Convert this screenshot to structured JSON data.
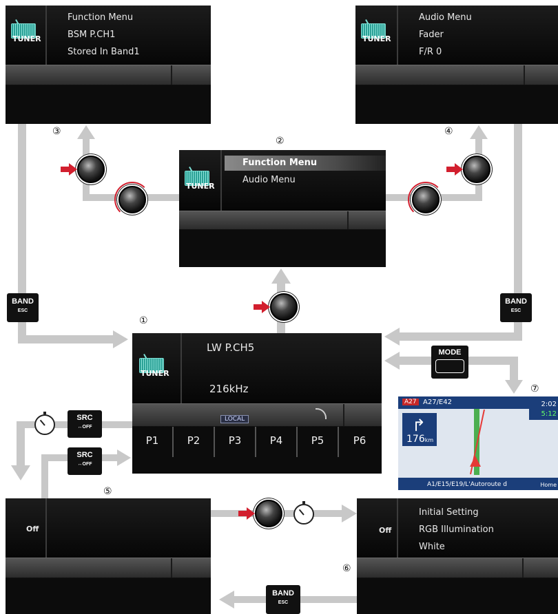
{
  "markers": {
    "m1": "①",
    "m2": "②",
    "m3": "③",
    "m4": "④",
    "m5": "⑤",
    "m6": "⑥",
    "m7": "⑦"
  },
  "tuner_label": "TUNER",
  "screen_top_left": {
    "line1": "Function Menu",
    "line2": "BSM P.CH1",
    "line3": "Stored In Band1"
  },
  "screen_top_right": {
    "line1": "Audio Menu",
    "line2": "Fader",
    "line3": "F/R 0"
  },
  "screen_center": {
    "item1": "Function Menu",
    "item2": "Audio Menu"
  },
  "screen_main": {
    "station": "LW P.CH5",
    "frequency": "216kHz",
    "local_badge": "LOCAL",
    "presets": [
      "P1",
      "P2",
      "P3",
      "P4",
      "P5",
      "P6"
    ]
  },
  "screen_off_left": {
    "label": "Off"
  },
  "screen_off_right": {
    "label": "Off",
    "line1": "Initial Setting",
    "line2": "RGB Illumination",
    "line3": "White"
  },
  "buttons": {
    "band_left": {
      "l1": "BAND",
      "l2": "ESC"
    },
    "band_right": {
      "l1": "BAND",
      "l2": "ESC"
    },
    "band_bottom": {
      "l1": "BAND",
      "l2": "ESC"
    },
    "src_top": {
      "l1": "SRC",
      "l2": "↔OFF"
    },
    "src_bottom": {
      "l1": "SRC",
      "l2": "↔OFF"
    },
    "mode": {
      "l1": "MODE"
    }
  },
  "nav": {
    "road_badge": "A27",
    "road": "A27/E42",
    "distance": "176",
    "unit": "km",
    "street": "A1/E15/E19/L'Autoroute d",
    "time1": "2:02",
    "time2": "5:12",
    "home": "Home"
  },
  "colors": {
    "arrow_gray": "#c8c8c8",
    "press_red": "#d21f2e",
    "tuner_teal": "#2e9e95"
  }
}
